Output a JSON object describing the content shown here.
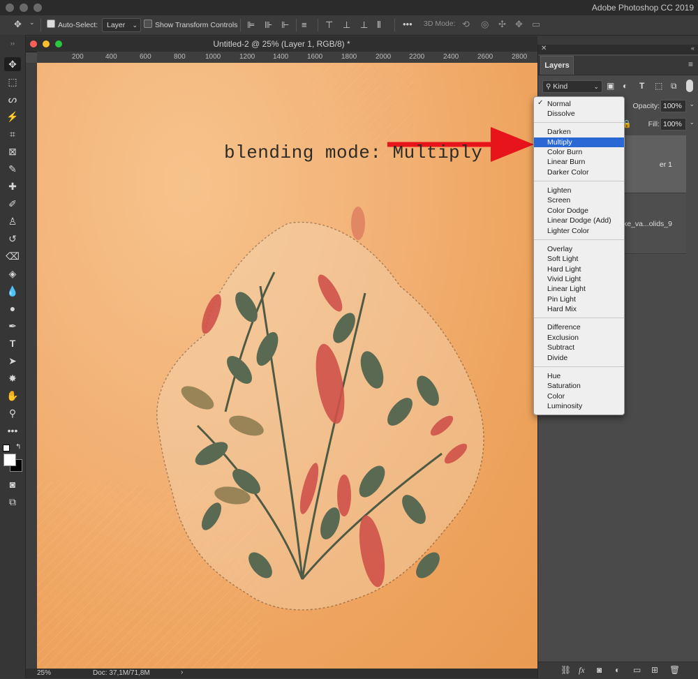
{
  "app": {
    "title": "Adobe Photoshop CC 2019"
  },
  "options_bar": {
    "auto_select_label": "Auto-Select:",
    "auto_select_value": "Layer",
    "show_transform_label": "Show Transform Controls",
    "mode_3d_label": "3D Mode:"
  },
  "document": {
    "title": "Untitled-2 @ 25% (Layer 1, RGB/8) *",
    "ruler_ticks": [
      "200",
      "400",
      "600",
      "800",
      "1000",
      "1200",
      "1400",
      "1600",
      "1800",
      "2000",
      "2200",
      "2400",
      "2600",
      "2800"
    ],
    "annotation": "blending mode: Multiply",
    "zoom": "25%",
    "doc_info": "Doc: 37,1M/71,8M"
  },
  "layers_panel": {
    "tab": "Layers",
    "kind": "Kind",
    "opacity_label": "Opacity:",
    "opacity_value": "100%",
    "fill_label": "Fill:",
    "fill_value": "100%",
    "layers": [
      {
        "name": "er 1"
      },
      {
        "name": "lke_va...olids_9"
      }
    ]
  },
  "blend_menu": {
    "selected": "Multiply",
    "checked": "Normal",
    "groups": [
      [
        "Normal",
        "Dissolve"
      ],
      [
        "Darken",
        "Multiply",
        "Color Burn",
        "Linear Burn",
        "Darker Color"
      ],
      [
        "Lighten",
        "Screen",
        "Color Dodge",
        "Linear Dodge (Add)",
        "Lighter Color"
      ],
      [
        "Overlay",
        "Soft Light",
        "Hard Light",
        "Vivid Light",
        "Linear Light",
        "Pin Light",
        "Hard Mix"
      ],
      [
        "Difference",
        "Exclusion",
        "Subtract",
        "Divide"
      ],
      [
        "Hue",
        "Saturation",
        "Color",
        "Luminosity"
      ]
    ]
  },
  "colors": {
    "accent": "#2a68d6",
    "arrow": "#e8141b",
    "canvas": "#f2ad6e"
  }
}
